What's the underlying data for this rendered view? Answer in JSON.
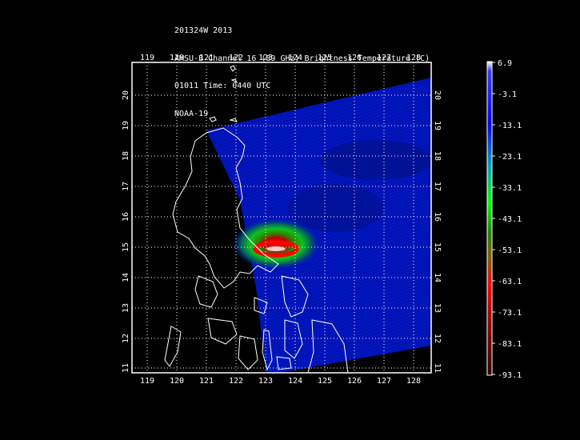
{
  "header": {
    "line1": "201324W 2013",
    "line2": "AMSU-B Channel 16 (89 GHz) Brightness Temperature (C)",
    "line3": "01011 Time: 0440 UTC",
    "line4": "NOAA-19"
  },
  "map": {
    "lon_ticks": [
      "119",
      "120",
      "121",
      "122",
      "123",
      "124",
      "125",
      "126",
      "127",
      "128"
    ],
    "lat_ticks": [
      "11",
      "12",
      "13",
      "14",
      "15",
      "16",
      "17",
      "18",
      "19",
      "20"
    ],
    "lon_range": [
      118.5,
      128.5
    ],
    "lat_range": [
      10.85,
      20.85
    ]
  },
  "colorbar": {
    "labels": [
      "6.9",
      "-3.1",
      "-13.1",
      "-23.1",
      "-33.1",
      "-43.1",
      "-53.1",
      "-63.1",
      "-73.1",
      "-83.1",
      "-93.1"
    ],
    "range": [
      -93.1,
      6.9
    ],
    "colors": [
      "#ffffff",
      "#7a1010",
      "#ff0000",
      "#ff8800",
      "#ffff00",
      "#00ff00",
      "#00aaff",
      "#0000ff",
      "#0000cc"
    ]
  },
  "chart_data": {
    "type": "heatmap",
    "title": "AMSU-B Channel 16 (89 GHz) Brightness Temperature (C)",
    "xlabel": "",
    "ylabel": "",
    "xlim": [
      118.5,
      128.5
    ],
    "ylim": [
      10.85,
      20.85
    ],
    "cbar_range": [
      -93.1,
      6.9
    ],
    "grid": true,
    "features": [
      {
        "name": "eye",
        "lon": 123.3,
        "lat": 14.8,
        "min_value": -83.1
      }
    ]
  }
}
